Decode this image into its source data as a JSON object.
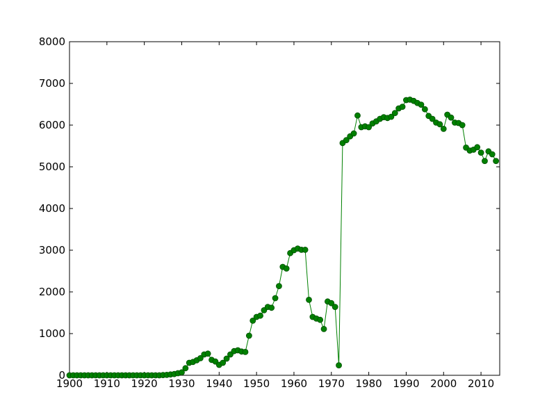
{
  "chart_data": {
    "type": "line",
    "title": "",
    "xlabel": "",
    "ylabel": "",
    "xlim": [
      1900,
      2015
    ],
    "ylim": [
      0,
      8000
    ],
    "grid": false,
    "legend": "none",
    "x_ticks": [
      1900,
      1910,
      1920,
      1930,
      1940,
      1950,
      1960,
      1970,
      1980,
      1990,
      2000,
      2010
    ],
    "y_ticks": [
      0,
      1000,
      2000,
      3000,
      4000,
      5000,
      6000,
      7000,
      8000
    ],
    "x_tick_labels": [
      "1900",
      "1910",
      "1920",
      "1930",
      "1940",
      "1950",
      "1960",
      "1970",
      "1980",
      "1990",
      "2000",
      "2010"
    ],
    "y_tick_labels": [
      "0",
      "1000",
      "2000",
      "3000",
      "4000",
      "5000",
      "6000",
      "7000",
      "8000"
    ],
    "colors": {
      "line": "#008000",
      "marker": "#008000",
      "marker_edge": "#004d00"
    },
    "series": [
      {
        "marker": "circle",
        "x": [
          1900,
          1901,
          1902,
          1903,
          1904,
          1905,
          1906,
          1907,
          1908,
          1909,
          1910,
          1911,
          1912,
          1913,
          1914,
          1915,
          1916,
          1917,
          1918,
          1919,
          1920,
          1921,
          1922,
          1923,
          1924,
          1925,
          1926,
          1927,
          1928,
          1929,
          1930,
          1931,
          1932,
          1933,
          1934,
          1935,
          1936,
          1937,
          1938,
          1939,
          1940,
          1941,
          1942,
          1943,
          1944,
          1945,
          1946,
          1947,
          1948,
          1949,
          1950,
          1951,
          1952,
          1953,
          1954,
          1955,
          1956,
          1957,
          1958,
          1959,
          1960,
          1961,
          1962,
          1963,
          1964,
          1965,
          1966,
          1967,
          1968,
          1969,
          1970,
          1971,
          1972,
          1973,
          1974,
          1975,
          1976,
          1977,
          1978,
          1979,
          1980,
          1981,
          1982,
          1983,
          1984,
          1985,
          1986,
          1987,
          1988,
          1989,
          1990,
          1991,
          1992,
          1993,
          1994,
          1995,
          1996,
          1997,
          1998,
          1999,
          2000,
          2001,
          2002,
          2003,
          2004,
          2005,
          2006,
          2007,
          2008,
          2009,
          2010,
          2011,
          2012,
          2013,
          2014
        ],
        "y": [
          0,
          0,
          0,
          0,
          0,
          0,
          0,
          0,
          0,
          0,
          0,
          0,
          0,
          0,
          0,
          0,
          0,
          0,
          0,
          0,
          0,
          0,
          0,
          0,
          0,
          5,
          10,
          20,
          30,
          50,
          70,
          170,
          300,
          320,
          360,
          410,
          500,
          520,
          370,
          330,
          250,
          300,
          400,
          500,
          580,
          600,
          570,
          560,
          950,
          1310,
          1400,
          1430,
          1560,
          1640,
          1620,
          1850,
          2140,
          2600,
          2560,
          2930,
          3000,
          3040,
          3010,
          3010,
          1810,
          1400,
          1360,
          1330,
          1110,
          1770,
          1730,
          1640,
          240,
          5570,
          5640,
          5730,
          5800,
          6230,
          5950,
          5970,
          5950,
          6040,
          6090,
          6150,
          6190,
          6170,
          6200,
          6290,
          6400,
          6440,
          6600,
          6610,
          6580,
          6530,
          6490,
          6380,
          6220,
          6150,
          6060,
          6020,
          5910,
          6250,
          6180,
          6060,
          6050,
          6000,
          5460,
          5390,
          5410,
          5470,
          5340,
          5140,
          5370,
          5300,
          5140
        ]
      }
    ]
  }
}
